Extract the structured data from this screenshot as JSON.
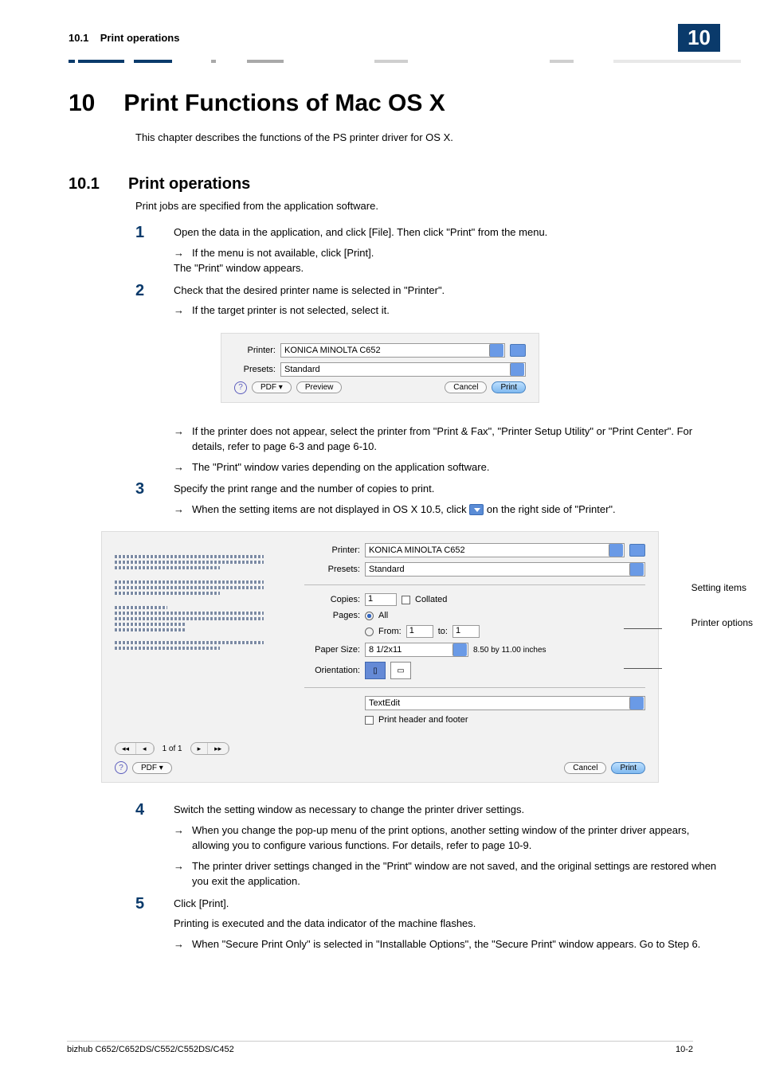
{
  "header": {
    "section_number": "10.1",
    "section_name": "Print operations",
    "chapter_tab": "10"
  },
  "chapter": {
    "number": "10",
    "title": "Print Functions of Mac OS X",
    "description": "This chapter describes the functions of the PS printer driver for OS X."
  },
  "section": {
    "number": "10.1",
    "title": "Print operations",
    "description": "Print jobs are specified from the application software."
  },
  "steps": {
    "s1": {
      "num": "1",
      "text": "Open the data in the application, and click [File]. Then click \"Print\" from the menu.",
      "b1": "If the menu is not available, click [Print].",
      "after": "The \"Print\" window appears."
    },
    "s2": {
      "num": "2",
      "text": "Check that the desired printer name is selected in \"Printer\".",
      "b1": "If the target printer is not selected, select it.",
      "b2": "If the printer does not appear, select the printer from \"Print & Fax\", \"Printer Setup Utility\" or \"Print Center\". For details, refer to page 6-3 and page 6-10.",
      "b3": "The \"Print\" window varies depending on the application software."
    },
    "s3": {
      "num": "3",
      "text": "Specify the print range and the number of copies to print.",
      "b1_pre": "When the setting items are not displayed in OS X 10.5, click ",
      "b1_post": " on the right side of \"Printer\"."
    },
    "s4": {
      "num": "4",
      "text": "Switch the setting window as necessary to change the printer driver settings.",
      "b1": "When you change the pop-up menu of the print options, another setting window of the printer driver appears, allowing you to configure various functions. For details, refer to page 10-9.",
      "b2": "The printer driver settings changed in the \"Print\" window are not saved, and the original settings are restored when you exit the application."
    },
    "s5": {
      "num": "5",
      "text": "Click [Print].",
      "after": "Printing is executed and the data indicator of the machine flashes.",
      "b1": "When \"Secure Print Only\" is selected in \"Installable Options\", the \"Secure Print\" window appears. Go to Step 6."
    }
  },
  "dialog1": {
    "printer_label": "Printer:",
    "printer_value": "KONICA MINOLTA C652",
    "presets_label": "Presets:",
    "presets_value": "Standard",
    "pdf_btn": "PDF ▾",
    "preview_btn": "Preview",
    "cancel_btn": "Cancel",
    "print_btn": "Print"
  },
  "dialog2": {
    "printer_label": "Printer:",
    "printer_value": "KONICA MINOLTA C652",
    "presets_label": "Presets:",
    "presets_value": "Standard",
    "copies_label": "Copies:",
    "copies_value": "1",
    "collated_label": "Collated",
    "pages_label": "Pages:",
    "all_label": "All",
    "from_label": "From:",
    "from_value": "1",
    "to_label": "to:",
    "to_value": "1",
    "papersize_label": "Paper Size:",
    "papersize_value": "8 1/2x11",
    "papersize_dims": "8.50 by 11.00 inches",
    "orientation_label": "Orientation:",
    "options_value": "TextEdit",
    "header_footer_label": "Print header and footer",
    "page_of": "1 of 1",
    "pdf_btn": "PDF ▾",
    "cancel_btn": "Cancel",
    "print_btn": "Print"
  },
  "callouts": {
    "c1": "Setting items",
    "c2": "Printer options"
  },
  "footer": {
    "left": "bizhub C652/C652DS/C552/C552DS/C452",
    "right": "10-2"
  }
}
